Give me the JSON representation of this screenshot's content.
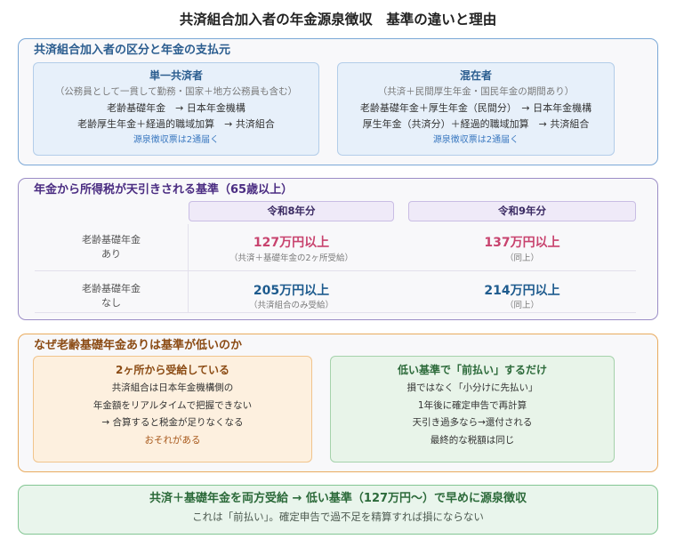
{
  "title": "共済組合加入者の年金源泉徴収　基準の違いと理由",
  "section_payers": {
    "heading": "共済組合加入者の区分と年金の支払元",
    "cards": [
      {
        "title": "単一共済者",
        "subtitle": "（公務員として一貫して勤務・国家＋地方公務員も含む）",
        "lines": [
          "老齢基礎年金　→ 日本年金機構",
          "老齢厚生年金＋経過的職域加算　→ 共済組合"
        ],
        "note": "源泉徴収票は2通届く"
      },
      {
        "title": "混在者",
        "subtitle": "（共済＋民間厚生年金・国民年金の期間あり）",
        "lines": [
          "老齢基礎年金＋厚生年金（民間分）　→ 日本年金機構",
          "厚生年金（共済分）＋経過的職域加算　→ 共済組合"
        ],
        "note": "源泉徴収票は2通届く"
      }
    ]
  },
  "section_threshold": {
    "heading": "年金から所得税が天引きされる基準（65歳以上）",
    "columns": [
      "令和8年分",
      "令和9年分"
    ],
    "rows": [
      {
        "label": [
          "老齢基礎年金",
          "あり"
        ],
        "cells": [
          {
            "value": "127万円以上",
            "note": "（共済＋基礎年金の2ヶ所受給）"
          },
          {
            "value": "137万円以上",
            "note": "（同上）"
          }
        ]
      },
      {
        "label": [
          "老齢基礎年金",
          "なし"
        ],
        "cells": [
          {
            "value": "205万円以上",
            "note": "（共済組合のみ受給）"
          },
          {
            "value": "214万円以上",
            "note": "（同上）"
          }
        ]
      }
    ]
  },
  "section_reason": {
    "heading": "なぜ老齢基礎年金ありは基準が低いのか",
    "cards": [
      {
        "title": "2ヶ所から受給している",
        "lines": [
          "共済組合は日本年金機構側の",
          "年金額をリアルタイムで把握できない",
          "→ 合算すると税金が足りなくなる",
          "おそれがある"
        ]
      },
      {
        "title": "低い基準で「前払い」するだけ",
        "lines": [
          "損ではなく「小分けに先払い」",
          "1年後に確定申告で再計算",
          "天引き過多なら→還付される",
          "最終的な税額は同じ"
        ]
      }
    ]
  },
  "summary": {
    "main": "共済＋基礎年金を両方受給 → 低い基準（127万円〜）で早めに源泉徴収",
    "sub": "これは「前払い」。確定申告で過不足を精算すれば損にならない"
  },
  "colors": {
    "payers_accent": "#2b5d8f",
    "payers_border": "#7ba8d7",
    "payers_card_bg": "#e7f0fa",
    "note_blue": "#3a78c0",
    "threshold_accent": "#4b2d82",
    "threshold_border": "#9b8dc6",
    "threshold_header_bg": "#efeaf8",
    "value_with_basic": "#c8436e",
    "value_without_basic": "#1e5b8e",
    "reason_accent": "#8b4b14",
    "reason_border": "#e9ab5e",
    "reason_left_bg": "#fdf0df",
    "reason_right_accent": "#2c6a3a",
    "reason_right_bg": "#e8f4e9",
    "summary_accent": "#2c6a3a",
    "summary_bg": "#e9f5ec",
    "summary_border": "#83c693"
  }
}
